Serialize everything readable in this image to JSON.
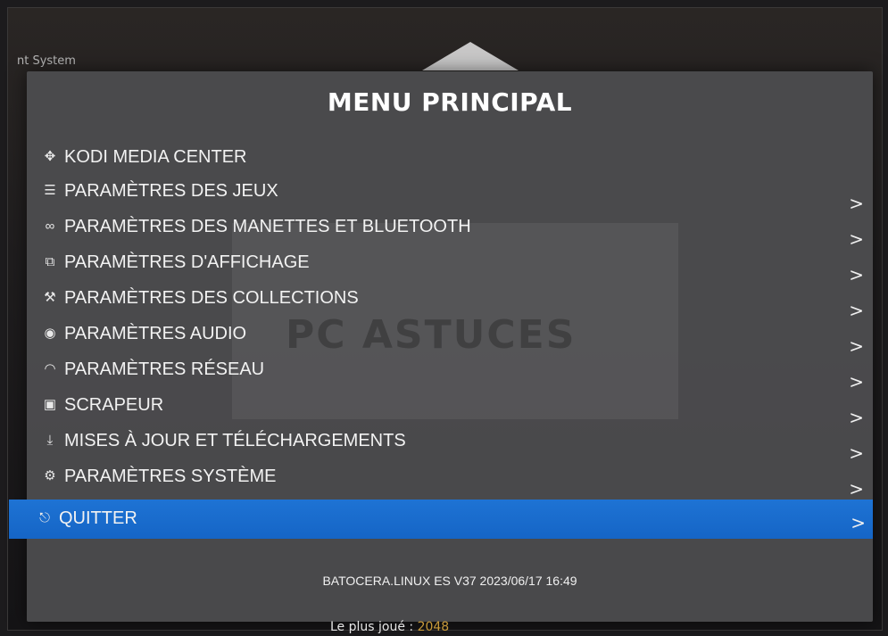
{
  "background": {
    "title": "nt System",
    "footer_label": "Le plus joué :",
    "footer_value": "2048"
  },
  "watermark": "PC ASTUCES",
  "menu": {
    "title": "MENU PRINCIPAL",
    "items": [
      {
        "icon": "kodi-icon",
        "label": "KODI MEDIA CENTER",
        "has_submenu": false
      },
      {
        "icon": "sliders-icon",
        "label": "PARAMÈTRES DES JEUX",
        "has_submenu": true
      },
      {
        "icon": "gamepad-icon",
        "label": "PARAMÈTRES DES MANETTES ET BLUETOOTH",
        "has_submenu": true
      },
      {
        "icon": "display-icon",
        "label": "PARAMÈTRES D'AFFICHAGE",
        "has_submenu": true
      },
      {
        "icon": "wrench-icon",
        "label": "PARAMÈTRES DES COLLECTIONS",
        "has_submenu": true
      },
      {
        "icon": "speaker-icon",
        "label": "PARAMÈTRES AUDIO",
        "has_submenu": true
      },
      {
        "icon": "wifi-icon",
        "label": "PARAMÈTRES RÉSEAU",
        "has_submenu": true
      },
      {
        "icon": "scraper-icon",
        "label": "SCRAPEUR",
        "has_submenu": true
      },
      {
        "icon": "download-icon",
        "label": "MISES À JOUR ET TÉLÉCHARGEMENTS",
        "has_submenu": true
      },
      {
        "icon": "settings-icon",
        "label": "PARAMÈTRES SYSTÈME",
        "has_submenu": true
      },
      {
        "icon": "exit-icon",
        "label": "QUITTER",
        "has_submenu": true,
        "selected": true
      }
    ],
    "chevron": ">",
    "footer": "BATOCERA.LINUX ES V37 2023/06/17 16:49"
  },
  "colors": {
    "selection": "#1a6ccf",
    "panel": "#4e4e50",
    "text": "#f2f2f2"
  }
}
